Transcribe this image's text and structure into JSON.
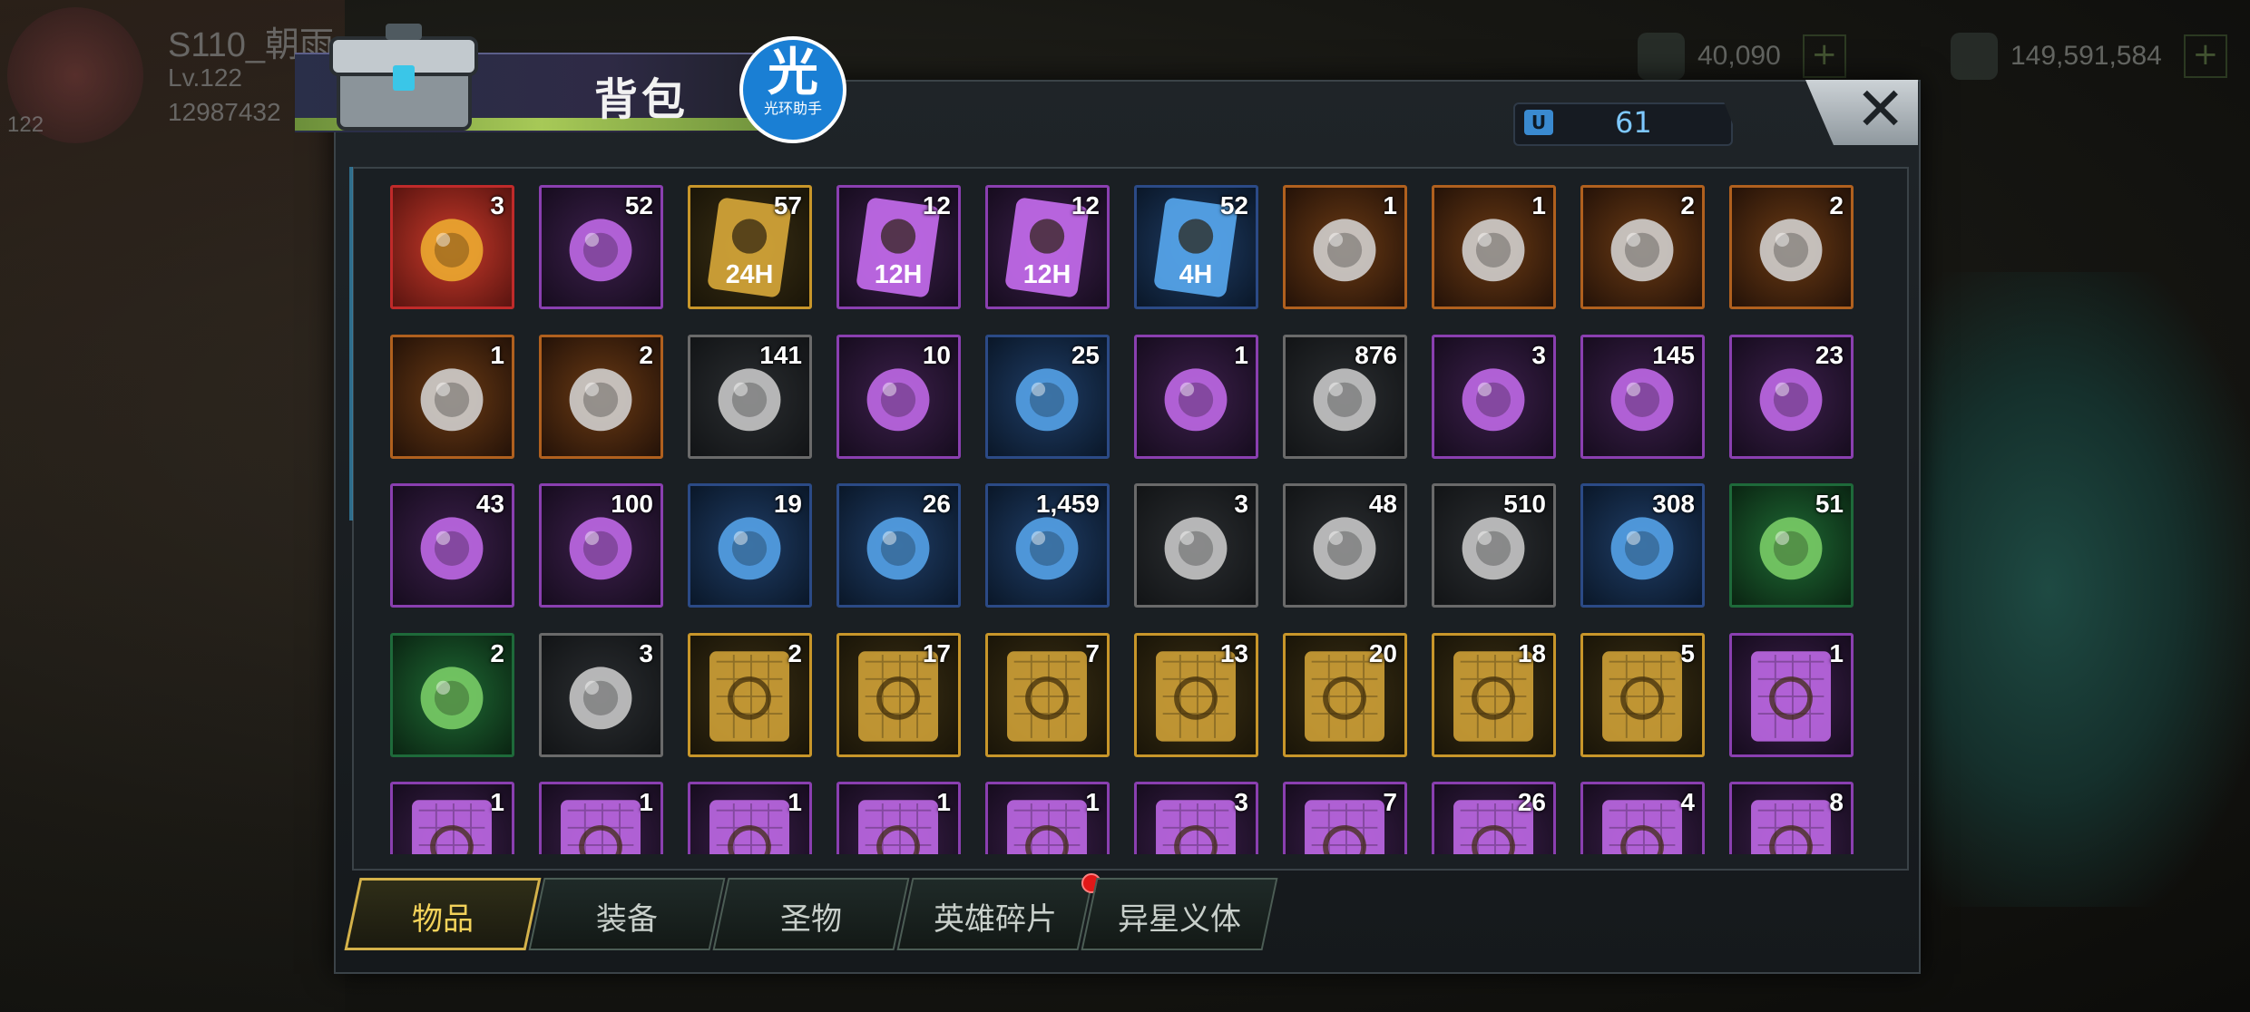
{
  "hud": {
    "player_name": "S110_朝雨",
    "level": "Lv.122",
    "power": "12987432",
    "level_badge": "122",
    "resource1": "40,090",
    "resource2": "149,591,584"
  },
  "panel": {
    "title": "背包",
    "capacity": "61",
    "close": "✕",
    "logo_main": "光",
    "logo_sub": "光环助手"
  },
  "rarity_colors": {
    "gold": "#c8962a",
    "purple": "#8a3fb0",
    "blue": "#2b4a86",
    "green": "#1e6a3a",
    "orange": "#b0601e",
    "gray": "#6a6a6a",
    "red": "#c02a2a"
  },
  "items": [
    {
      "count": "3",
      "rarity": "red",
      "icon": "sss-chest-icon"
    },
    {
      "count": "52",
      "rarity": "purple",
      "icon": "teleport-icon"
    },
    {
      "count": "57",
      "rarity": "gold",
      "icon": "speedup-24h-icon",
      "tag": "24H"
    },
    {
      "count": "12",
      "rarity": "purple",
      "icon": "speedup-12h-icon",
      "tag": "12H"
    },
    {
      "count": "12",
      "rarity": "purple",
      "icon": "speedup-12h-icon",
      "tag": "12H"
    },
    {
      "count": "52",
      "rarity": "blue",
      "icon": "speedup-4h-icon",
      "tag": "4H"
    },
    {
      "count": "1",
      "rarity": "orange",
      "icon": "badge-icon"
    },
    {
      "count": "1",
      "rarity": "orange",
      "icon": "mask-icon"
    },
    {
      "count": "2",
      "rarity": "orange",
      "icon": "leaf-emblem-icon"
    },
    {
      "count": "2",
      "rarity": "orange",
      "icon": "coin-emblem-icon"
    },
    {
      "count": "1",
      "rarity": "orange",
      "icon": "target-emblem-icon"
    },
    {
      "count": "2",
      "rarity": "orange",
      "icon": "radiation-emblem-icon"
    },
    {
      "count": "141",
      "rarity": "gray",
      "icon": "bottle-cap-red-icon"
    },
    {
      "count": "10",
      "rarity": "purple",
      "icon": "vault-coin-icon"
    },
    {
      "count": "25",
      "rarity": "blue",
      "icon": "ticket-icon"
    },
    {
      "count": "1",
      "rarity": "purple",
      "icon": "cube-icon"
    },
    {
      "count": "876",
      "rarity": "gray",
      "icon": "fish-icon"
    },
    {
      "count": "3",
      "rarity": "purple",
      "icon": "crystal-icon"
    },
    {
      "count": "145",
      "rarity": "purple",
      "icon": "film-reel-icon"
    },
    {
      "count": "23",
      "rarity": "purple",
      "icon": "bottle-cap-pink-icon"
    },
    {
      "count": "43",
      "rarity": "purple",
      "icon": "poker-chip-icon"
    },
    {
      "count": "100",
      "rarity": "purple",
      "icon": "police-badge-icon"
    },
    {
      "count": "19",
      "rarity": "blue",
      "icon": "green-slime-icon"
    },
    {
      "count": "26",
      "rarity": "blue",
      "icon": "bunny-coin-icon"
    },
    {
      "count": "1,459",
      "rarity": "blue",
      "icon": "cinema-ticket-icon"
    },
    {
      "count": "3",
      "rarity": "gray",
      "icon": "timer-icon"
    },
    {
      "count": "48",
      "rarity": "gray",
      "icon": "bottle-cap-blue-icon"
    },
    {
      "count": "510",
      "rarity": "gray",
      "icon": "casino-chip-icon"
    },
    {
      "count": "308",
      "rarity": "blue",
      "icon": "bullet-icon"
    },
    {
      "count": "51",
      "rarity": "green",
      "icon": "bear-plush-icon"
    },
    {
      "count": "2",
      "rarity": "green",
      "icon": "metal-shard-green-icon"
    },
    {
      "count": "3",
      "rarity": "gray",
      "icon": "metal-shard-icon"
    },
    {
      "count": "2",
      "rarity": "gold",
      "icon": "blueprint-boots-icon"
    },
    {
      "count": "17",
      "rarity": "gold",
      "icon": "blueprint-swords-icon"
    },
    {
      "count": "7",
      "rarity": "gold",
      "icon": "blueprint-gun-icon"
    },
    {
      "count": "13",
      "rarity": "gold",
      "icon": "blueprint-boots-icon"
    },
    {
      "count": "20",
      "rarity": "gold",
      "icon": "blueprint-revolver-icon"
    },
    {
      "count": "18",
      "rarity": "gold",
      "icon": "blueprint-shirt-icon"
    },
    {
      "count": "5",
      "rarity": "gold",
      "icon": "blueprint-hat-icon"
    },
    {
      "count": "1",
      "rarity": "purple",
      "icon": "blueprint-shirt-icon"
    },
    {
      "count": "1",
      "rarity": "purple",
      "icon": "blueprint-icon"
    },
    {
      "count": "1",
      "rarity": "purple",
      "icon": "blueprint-icon"
    },
    {
      "count": "1",
      "rarity": "purple",
      "icon": "blueprint-icon"
    },
    {
      "count": "1",
      "rarity": "purple",
      "icon": "blueprint-icon"
    },
    {
      "count": "1",
      "rarity": "purple",
      "icon": "blueprint-icon"
    },
    {
      "count": "3",
      "rarity": "purple",
      "icon": "blueprint-icon"
    },
    {
      "count": "7",
      "rarity": "purple",
      "icon": "blueprint-icon"
    },
    {
      "count": "26",
      "rarity": "purple",
      "icon": "blueprint-icon"
    },
    {
      "count": "4",
      "rarity": "purple",
      "icon": "blueprint-icon"
    },
    {
      "count": "8",
      "rarity": "purple",
      "icon": "blueprint-icon"
    }
  ],
  "tabs": [
    {
      "label": "物品",
      "active": true
    },
    {
      "label": "装备",
      "active": false
    },
    {
      "label": "圣物",
      "active": false
    },
    {
      "label": "英雄碎片",
      "active": false,
      "badge": true
    },
    {
      "label": "异星义体",
      "active": false
    }
  ]
}
